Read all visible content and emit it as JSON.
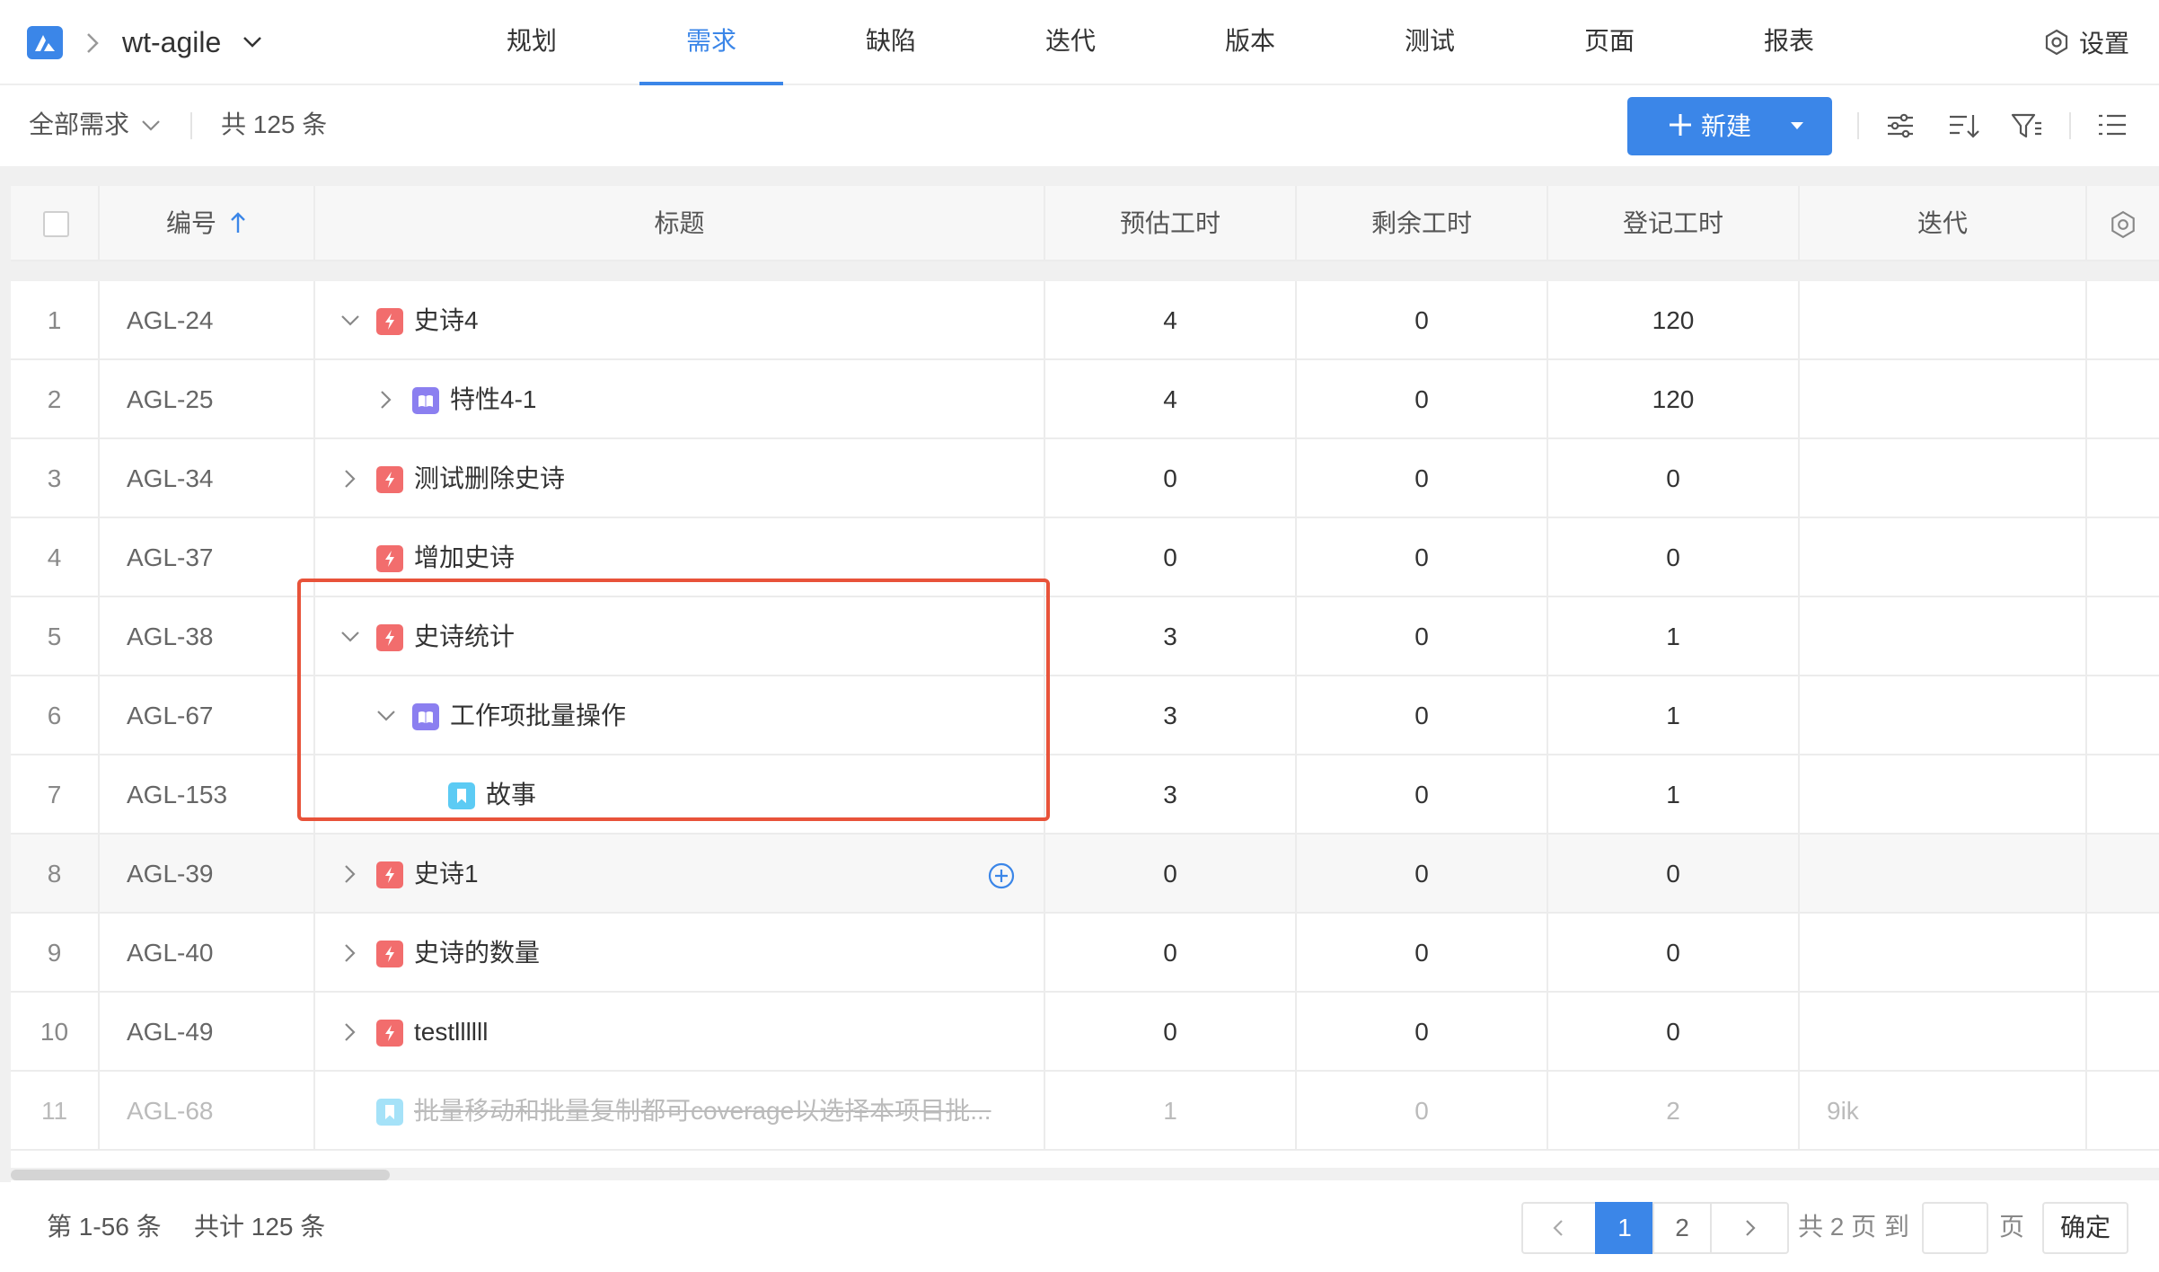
{
  "app": {
    "project_name": "wt-agile",
    "accent_color": "#3b86e8"
  },
  "nav": {
    "tabs": [
      {
        "label": "规划"
      },
      {
        "label": "需求",
        "active": true
      },
      {
        "label": "缺陷"
      },
      {
        "label": "迭代"
      },
      {
        "label": "版本"
      },
      {
        "label": "测试"
      },
      {
        "label": "页面"
      },
      {
        "label": "报表"
      }
    ],
    "settings_label": "设置"
  },
  "toolbar": {
    "filter_label": "全部需求",
    "total_label": "共 125 条",
    "new_button_label": "新建",
    "icons": [
      "sliders-icon",
      "sort-icon",
      "filter-icon",
      "list-view-icon"
    ]
  },
  "table": {
    "columns": {
      "key": "编号",
      "title": "标题",
      "estimated": "预估工时",
      "remaining": "剩余工时",
      "logged": "登记工时",
      "iteration": "迭代"
    },
    "rows": [
      {
        "index": "1",
        "key": "AGL-24",
        "title": "史诗4",
        "type": "epic",
        "depth": 0,
        "expander": "expanded",
        "estimated": "4",
        "remaining": "0",
        "logged": "120",
        "iteration": ""
      },
      {
        "index": "2",
        "key": "AGL-25",
        "title": "特性4-1",
        "type": "feature",
        "depth": 1,
        "expander": "collapsed",
        "estimated": "4",
        "remaining": "0",
        "logged": "120",
        "iteration": ""
      },
      {
        "index": "3",
        "key": "AGL-34",
        "title": "测试删除史诗",
        "type": "epic",
        "depth": 0,
        "expander": "collapsed",
        "estimated": "0",
        "remaining": "0",
        "logged": "0",
        "iteration": ""
      },
      {
        "index": "4",
        "key": "AGL-37",
        "title": "增加史诗",
        "type": "epic",
        "depth": 0,
        "expander": "none",
        "estimated": "0",
        "remaining": "0",
        "logged": "0",
        "iteration": ""
      },
      {
        "index": "5",
        "key": "AGL-38",
        "title": "史诗统计",
        "type": "epic",
        "depth": 0,
        "expander": "expanded",
        "estimated": "3",
        "remaining": "0",
        "logged": "1",
        "iteration": ""
      },
      {
        "index": "6",
        "key": "AGL-67",
        "title": "工作项批量操作",
        "type": "feature",
        "depth": 1,
        "expander": "expanded",
        "estimated": "3",
        "remaining": "0",
        "logged": "1",
        "iteration": ""
      },
      {
        "index": "7",
        "key": "AGL-153",
        "title": "故事",
        "type": "story",
        "depth": 2,
        "expander": "none",
        "estimated": "3",
        "remaining": "0",
        "logged": "1",
        "iteration": ""
      },
      {
        "index": "8",
        "key": "AGL-39",
        "title": "史诗1",
        "type": "epic",
        "depth": 0,
        "expander": "collapsed",
        "estimated": "0",
        "remaining": "0",
        "logged": "0",
        "iteration": "",
        "hover": true
      },
      {
        "index": "9",
        "key": "AGL-40",
        "title": "史诗的数量",
        "type": "epic",
        "depth": 0,
        "expander": "collapsed",
        "estimated": "0",
        "remaining": "0",
        "logged": "0",
        "iteration": ""
      },
      {
        "index": "10",
        "key": "AGL-49",
        "title": "testllllll",
        "type": "epic",
        "depth": 0,
        "expander": "collapsed",
        "estimated": "0",
        "remaining": "0",
        "logged": "0",
        "iteration": ""
      },
      {
        "index": "11",
        "key": "AGL-68",
        "title": "批量移动和批量复制都可coverage以选择本项目批...",
        "type": "story",
        "depth": 0,
        "expander": "none",
        "estimated": "1",
        "remaining": "0",
        "logged": "2",
        "iteration": "9ik",
        "done": true
      }
    ]
  },
  "footer": {
    "range_label": "第 1-56 条",
    "count_label": "共计 125 条",
    "pages": [
      "1",
      "2"
    ],
    "current_page": "1",
    "total_pages_label": "共 2 页",
    "goto_label": "到",
    "page_suffix": "页",
    "confirm_label": "确定"
  }
}
